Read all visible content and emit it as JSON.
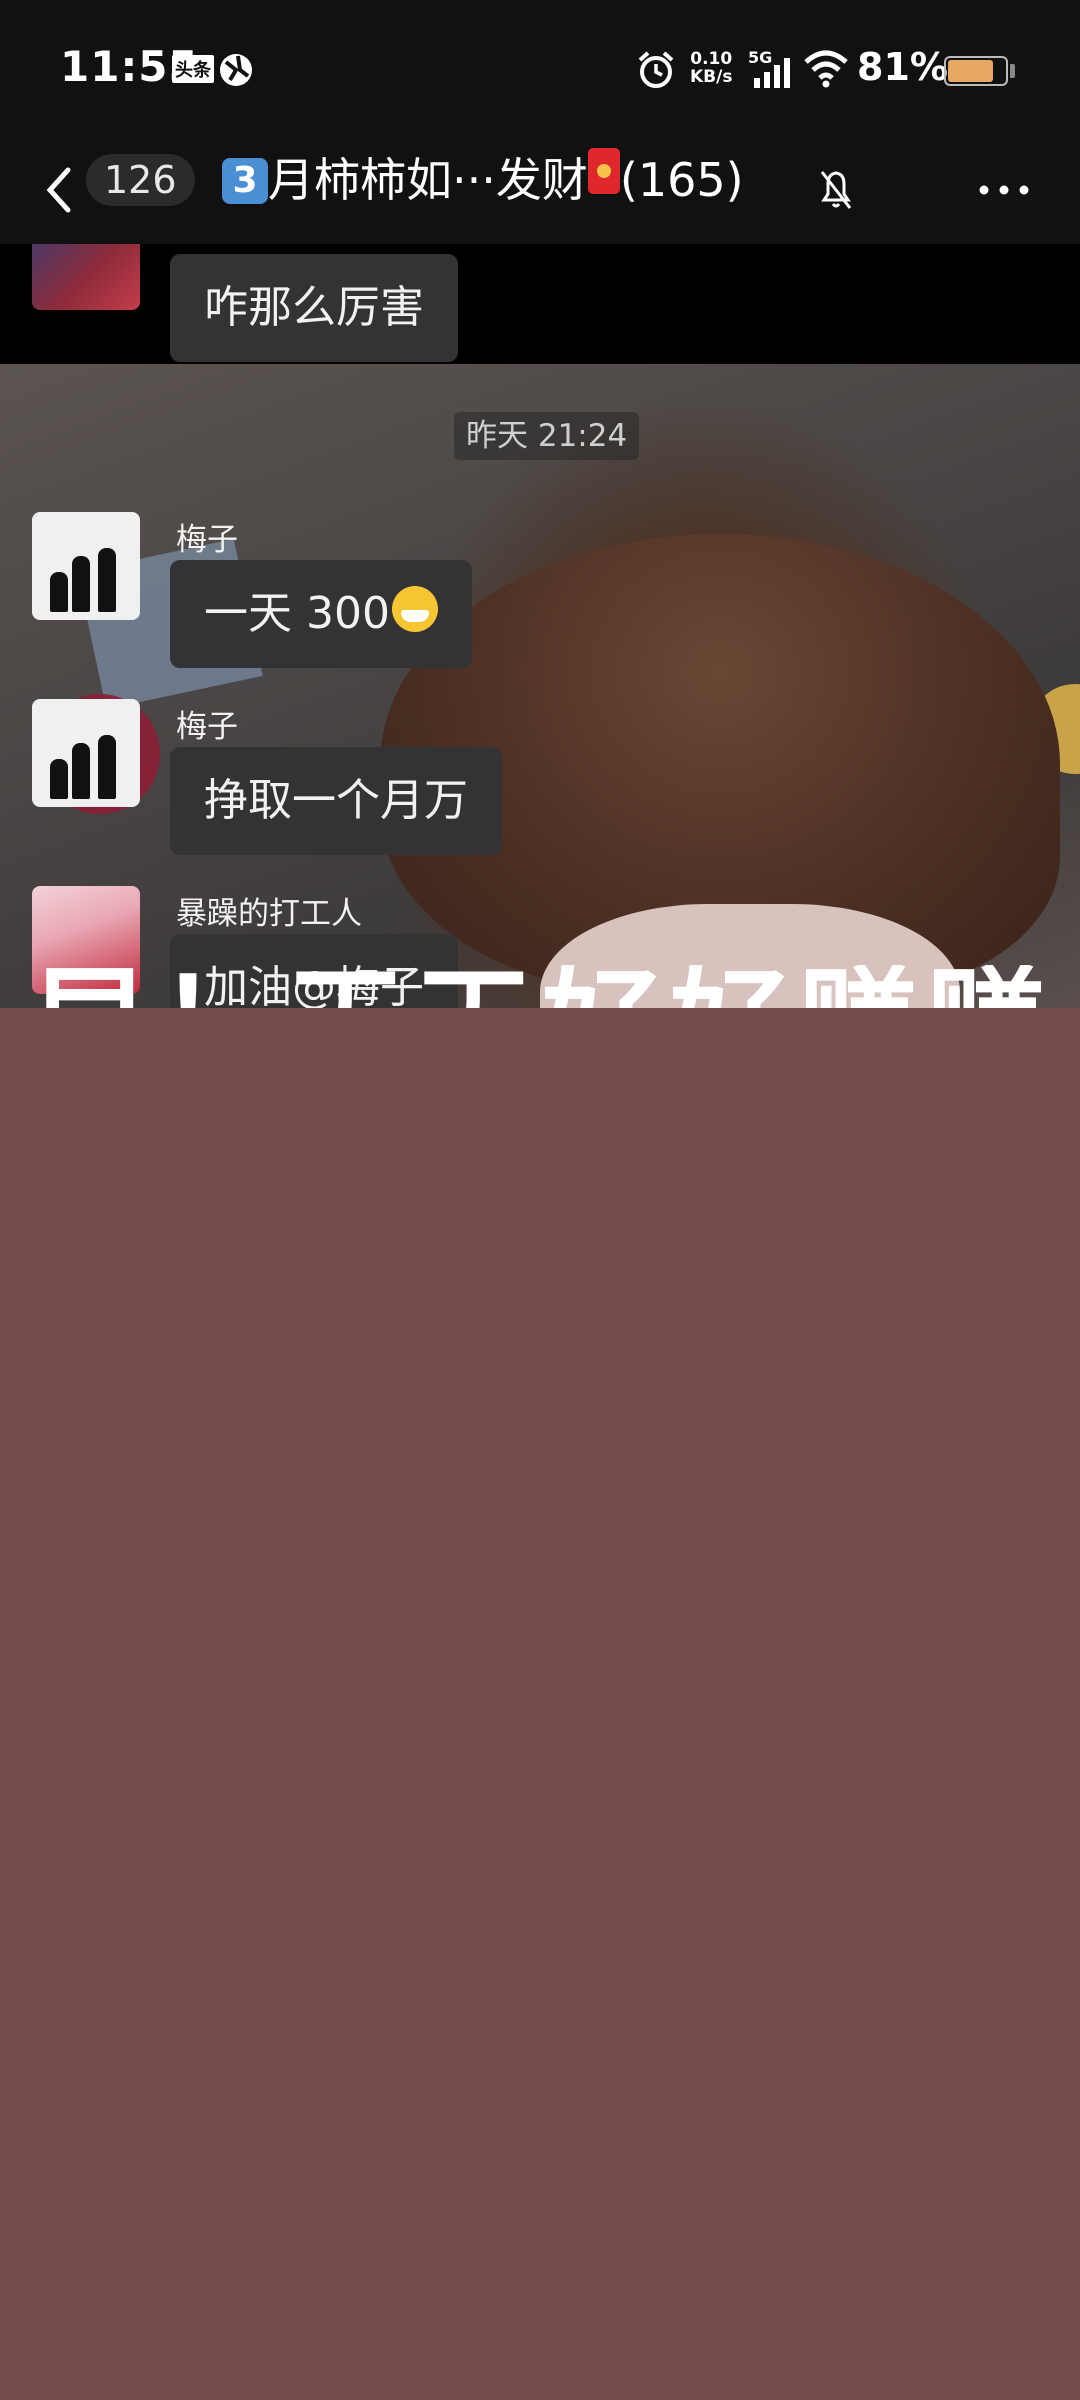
{
  "status_bar": {
    "time": "11:55",
    "app_badge": "头条",
    "net_speed_value": "0.10",
    "net_speed_unit": "KB/s",
    "network": "5G",
    "battery_pct": "81%",
    "battery_level": 0.81,
    "battery_color": "#e8a863"
  },
  "nav": {
    "unread_count": "126",
    "title_num": "3",
    "title_text": "月柿柿如···发财",
    "member_count": "(165)"
  },
  "messages": [
    {
      "sender": "",
      "text": "咋那么厉害"
    },
    {
      "sender": "梅子",
      "text": "一天 300"
    },
    {
      "sender": "梅子",
      "text": "挣取一个月万"
    },
    {
      "sender": "暴躁的打工人",
      "text": "加油@梅子"
    }
  ],
  "timestamp": "昨天 21:24",
  "overlay_caption": "早！天天好好赚赚"
}
